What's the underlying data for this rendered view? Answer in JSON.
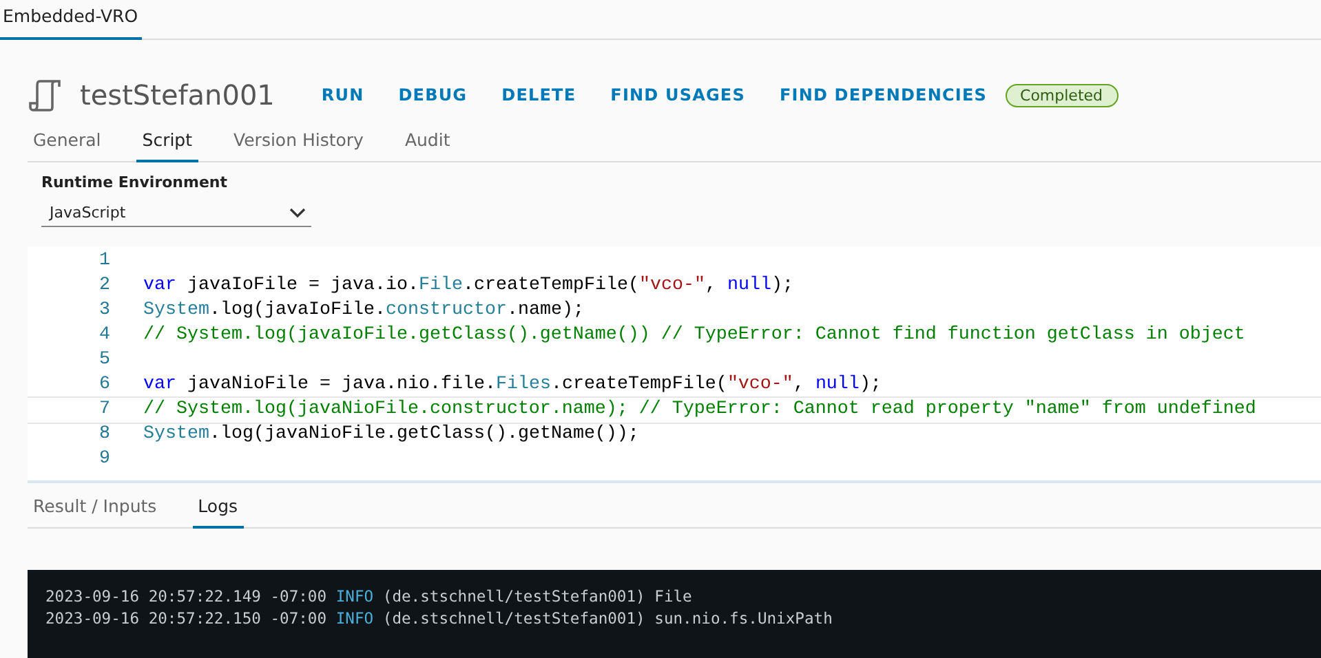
{
  "top_tabs": [
    {
      "label": "Embedded-VRO",
      "selected": true
    }
  ],
  "header": {
    "title": "testStefan001",
    "actions": [
      "RUN",
      "DEBUG",
      "DELETE",
      "FIND USAGES",
      "FIND DEPENDENCIES"
    ],
    "status": "Completed"
  },
  "tabs": [
    {
      "label": "General",
      "selected": false
    },
    {
      "label": "Script",
      "selected": true
    },
    {
      "label": "Version History",
      "selected": false
    },
    {
      "label": "Audit",
      "selected": false
    }
  ],
  "runtime": {
    "label": "Runtime Environment",
    "value": "JavaScript"
  },
  "code": {
    "lines": [
      {
        "number": "1",
        "active": false
      },
      {
        "number": "2",
        "active": false,
        "tokens": [
          {
            "text": "var",
            "kind": "keyword"
          },
          {
            "text": " javaIoFile = java.io.",
            "kind": "plain"
          },
          {
            "text": "File",
            "kind": "type"
          },
          {
            "text": ".createTempFile(",
            "kind": "plain"
          },
          {
            "text": "\"vco-\"",
            "kind": "string"
          },
          {
            "text": ", ",
            "kind": "plain"
          },
          {
            "text": "null",
            "kind": "keyword"
          },
          {
            "text": ");",
            "kind": "plain"
          }
        ]
      },
      {
        "number": "3",
        "active": false,
        "tokens": [
          {
            "text": "System",
            "kind": "type"
          },
          {
            "text": ".log(javaIoFile.",
            "kind": "plain"
          },
          {
            "text": "constructor",
            "kind": "type"
          },
          {
            "text": ".name);",
            "kind": "plain"
          }
        ]
      },
      {
        "number": "4",
        "active": false,
        "tokens": [
          {
            "text": "// System.log(javaIoFile.getClass().getName()) // TypeError: Cannot find function getClass in object",
            "kind": "comment"
          }
        ]
      },
      {
        "number": "5",
        "active": false
      },
      {
        "number": "6",
        "active": false,
        "tokens": [
          {
            "text": "var",
            "kind": "keyword"
          },
          {
            "text": " javaNioFile = java.nio.file.",
            "kind": "plain"
          },
          {
            "text": "Files",
            "kind": "type"
          },
          {
            "text": ".createTempFile(",
            "kind": "plain"
          },
          {
            "text": "\"vco-\"",
            "kind": "string"
          },
          {
            "text": ", ",
            "kind": "plain"
          },
          {
            "text": "null",
            "kind": "keyword"
          },
          {
            "text": ");",
            "kind": "plain"
          }
        ]
      },
      {
        "number": "7",
        "active": true,
        "tokens": [
          {
            "text": "// System.log(javaNioFile.constructor.name); // TypeError: Cannot read property \"name\" from undefined",
            "kind": "comment"
          }
        ]
      },
      {
        "number": "8",
        "active": false,
        "tokens": [
          {
            "text": "System",
            "kind": "type"
          },
          {
            "text": ".log(javaNioFile.getClass().getName());",
            "kind": "plain"
          }
        ]
      },
      {
        "number": "9",
        "active": false
      }
    ]
  },
  "bottom_tabs": [
    {
      "label": "Result / Inputs",
      "selected": false
    },
    {
      "label": "Logs",
      "selected": true
    }
  ],
  "logs": [
    {
      "time": "2023-09-16 20:57:22.149 -07:00",
      "level": "INFO",
      "source": "(de.stschnell/testStefan001)",
      "message": "File"
    },
    {
      "time": "2023-09-16 20:57:22.150 -07:00",
      "level": "INFO",
      "source": "(de.stschnell/testStefan001)",
      "message": "sun.nio.fs.UnixPath"
    }
  ]
}
